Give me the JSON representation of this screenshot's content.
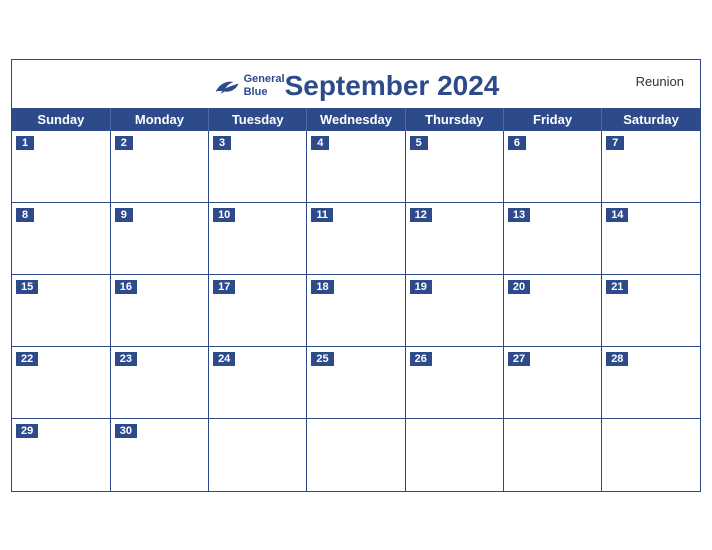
{
  "calendar": {
    "title": "September 2024",
    "region": "Reunion",
    "logo": {
      "line1": "General",
      "line2": "Blue"
    },
    "days_of_week": [
      "Sunday",
      "Monday",
      "Tuesday",
      "Wednesday",
      "Thursday",
      "Friday",
      "Saturday"
    ],
    "weeks": [
      [
        {
          "date": "1",
          "empty": false
        },
        {
          "date": "2",
          "empty": false
        },
        {
          "date": "3",
          "empty": false
        },
        {
          "date": "4",
          "empty": false
        },
        {
          "date": "5",
          "empty": false
        },
        {
          "date": "6",
          "empty": false
        },
        {
          "date": "7",
          "empty": false
        }
      ],
      [
        {
          "date": "8",
          "empty": false
        },
        {
          "date": "9",
          "empty": false
        },
        {
          "date": "10",
          "empty": false
        },
        {
          "date": "11",
          "empty": false
        },
        {
          "date": "12",
          "empty": false
        },
        {
          "date": "13",
          "empty": false
        },
        {
          "date": "14",
          "empty": false
        }
      ],
      [
        {
          "date": "15",
          "empty": false
        },
        {
          "date": "16",
          "empty": false
        },
        {
          "date": "17",
          "empty": false
        },
        {
          "date": "18",
          "empty": false
        },
        {
          "date": "19",
          "empty": false
        },
        {
          "date": "20",
          "empty": false
        },
        {
          "date": "21",
          "empty": false
        }
      ],
      [
        {
          "date": "22",
          "empty": false
        },
        {
          "date": "23",
          "empty": false
        },
        {
          "date": "24",
          "empty": false
        },
        {
          "date": "25",
          "empty": false
        },
        {
          "date": "26",
          "empty": false
        },
        {
          "date": "27",
          "empty": false
        },
        {
          "date": "28",
          "empty": false
        }
      ],
      [
        {
          "date": "29",
          "empty": false
        },
        {
          "date": "30",
          "empty": false
        },
        {
          "date": "",
          "empty": true
        },
        {
          "date": "",
          "empty": true
        },
        {
          "date": "",
          "empty": true
        },
        {
          "date": "",
          "empty": true
        },
        {
          "date": "",
          "empty": true
        }
      ]
    ]
  }
}
